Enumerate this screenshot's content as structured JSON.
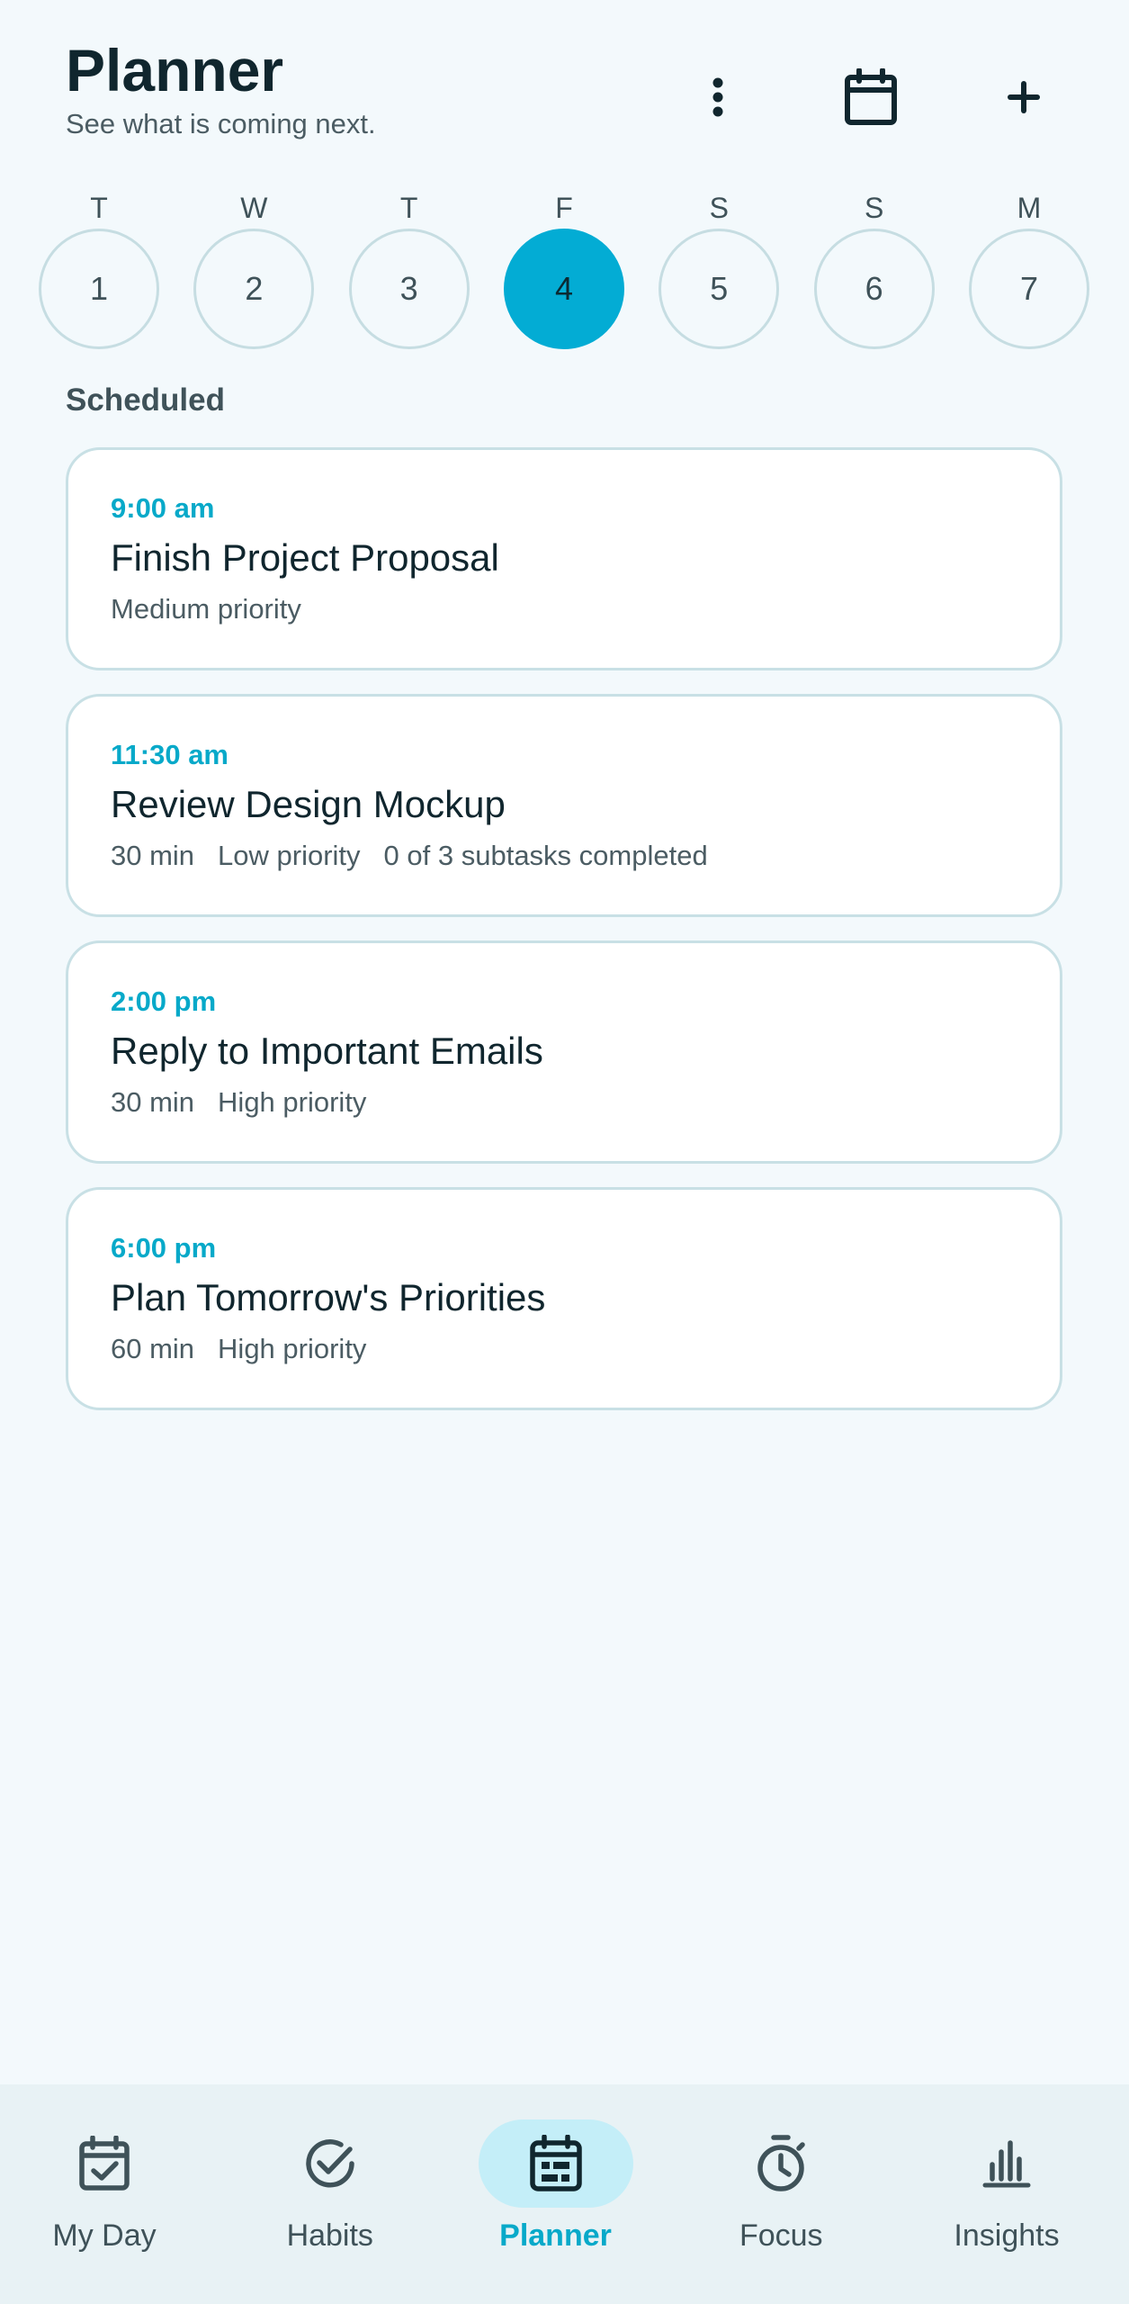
{
  "header": {
    "title": "Planner",
    "subtitle": "See what is coming next.",
    "actions": {
      "more": "more-vertical-icon",
      "calendar": "calendar-icon",
      "add": "plus-icon"
    }
  },
  "week": [
    {
      "letter": "T",
      "number": "1",
      "selected": false
    },
    {
      "letter": "W",
      "number": "2",
      "selected": false
    },
    {
      "letter": "T",
      "number": "3",
      "selected": false
    },
    {
      "letter": "F",
      "number": "4",
      "selected": true
    },
    {
      "letter": "S",
      "number": "5",
      "selected": false
    },
    {
      "letter": "S",
      "number": "6",
      "selected": false
    },
    {
      "letter": "M",
      "number": "7",
      "selected": false
    }
  ],
  "section_label": "Scheduled",
  "tasks": [
    {
      "time": "9:00 am",
      "title": "Finish Project Proposal",
      "meta": [
        "Medium priority"
      ]
    },
    {
      "time": "11:30 am",
      "title": "Review Design Mockup",
      "meta": [
        "30 min",
        "Low priority",
        "0 of 3 subtasks completed"
      ]
    },
    {
      "time": "2:00 pm",
      "title": "Reply to Important Emails",
      "meta": [
        "30 min",
        "High priority"
      ]
    },
    {
      "time": "6:00 pm",
      "title": "Plan Tomorrow's Priorities",
      "meta": [
        "60 min",
        "High priority"
      ]
    }
  ],
  "nav": [
    {
      "label": "My Day",
      "icon": "calendar-check-icon",
      "active": false
    },
    {
      "label": "Habits",
      "icon": "check-circle-icon",
      "active": false
    },
    {
      "label": "Planner",
      "icon": "calendar-grid-icon",
      "active": true
    },
    {
      "label": "Focus",
      "icon": "stopwatch-icon",
      "active": false
    },
    {
      "label": "Insights",
      "icon": "bar-chart-icon",
      "active": false
    }
  ],
  "colors": {
    "accent": "#03acd4",
    "accent_text": "#07a9c9",
    "background": "#f3f9fc",
    "card_border": "#c8e0e5",
    "nav_background": "#e8f2f5",
    "nav_active_pill": "#c4eef8"
  }
}
